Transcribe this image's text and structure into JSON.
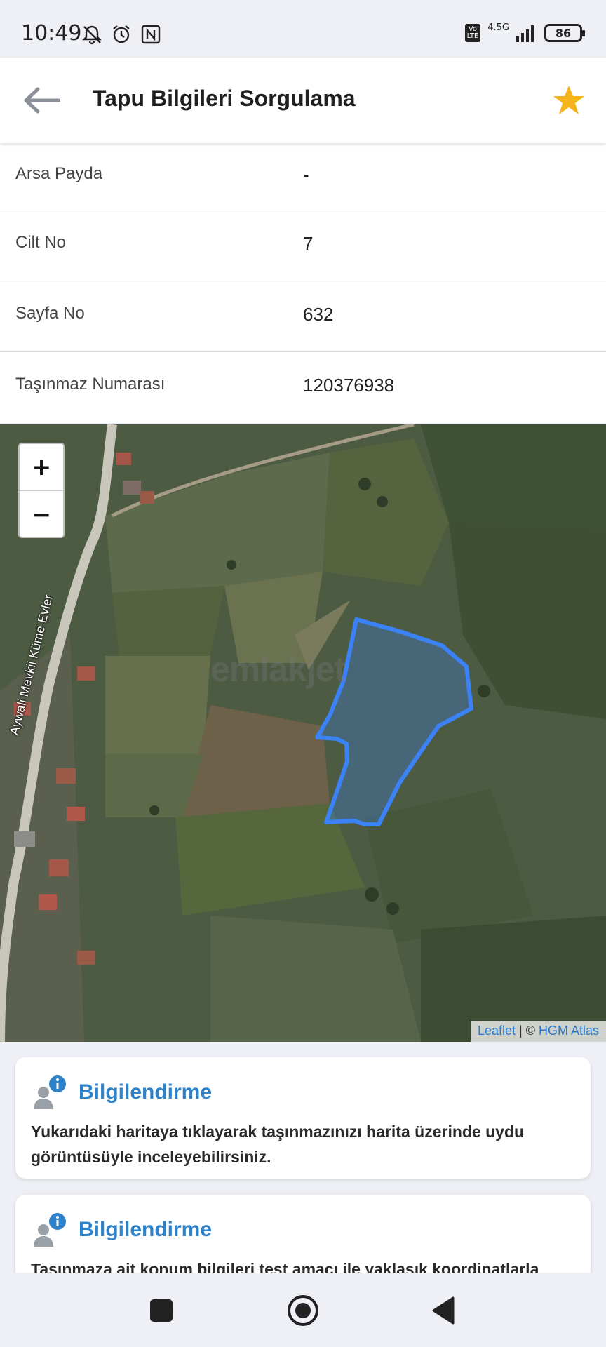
{
  "status_bar": {
    "time": "10:49",
    "network": "4.5G",
    "volte": "Vo\nLTE",
    "battery": "86",
    "icons": [
      "mute-bell-icon",
      "alarm-icon",
      "nfc-icon",
      "signal-icon",
      "battery-icon"
    ]
  },
  "app_bar": {
    "title": "Tapu Bilgileri Sorgulama",
    "back_icon": "arrow-left-icon",
    "favorite_icon": "star-icon",
    "star_color": "#f5b41d"
  },
  "info_rows": [
    {
      "label": "Arsa Payda",
      "value": "-"
    },
    {
      "label": "Cilt No",
      "value": "7"
    },
    {
      "label": "Sayfa No",
      "value": "632"
    },
    {
      "label": "Taşınmaz Numarası",
      "value": "120376938"
    }
  ],
  "map": {
    "zoom_in": "+",
    "zoom_out": "−",
    "watermark": "emlakjet",
    "road_label": "Aywali Mevkii Küme Evler",
    "attribution": {
      "leaflet": "Leaflet",
      "separator": " | © ",
      "provider": "HGM Atlas"
    },
    "parcel_color": "#3b82f6"
  },
  "cards": [
    {
      "title": "Bilgilendirme",
      "text": "Yukarıdaki haritaya tıklayarak taşınmazınızı harita üzerinde uydu görüntüsüyle inceleyebilirsiniz."
    },
    {
      "title": "Bilgilendirme",
      "text": "Taşınmaza ait konum bilgileri test amacı ile yaklaşık koordinatlarla"
    }
  ],
  "nav": {
    "recent_icon": "square-icon",
    "home_icon": "circle-icon",
    "back_icon": "triangle-back-icon"
  }
}
